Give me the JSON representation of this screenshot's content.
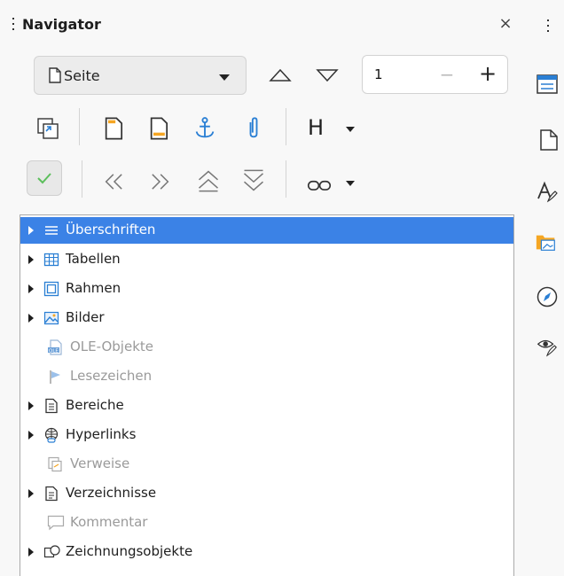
{
  "panel": {
    "title": "Navigator",
    "close_glyph": "×"
  },
  "toolbar": {
    "content_type": "Seite",
    "page_number": "1",
    "minus_glyph": "−",
    "plus_glyph": "+",
    "heading_level_glyph": "H"
  },
  "tree": {
    "items": [
      {
        "label": "Überschriften",
        "icon": "headings-icon",
        "expandable": true,
        "selected": true,
        "disabled": false
      },
      {
        "label": "Tabellen",
        "icon": "table-icon",
        "expandable": true,
        "selected": false,
        "disabled": false
      },
      {
        "label": "Rahmen",
        "icon": "frame-icon",
        "expandable": true,
        "selected": false,
        "disabled": false
      },
      {
        "label": "Bilder",
        "icon": "image-icon",
        "expandable": true,
        "selected": false,
        "disabled": false
      },
      {
        "label": "OLE-Objekte",
        "icon": "ole-object-icon",
        "expandable": false,
        "selected": false,
        "disabled": true
      },
      {
        "label": "Lesezeichen",
        "icon": "bookmark-icon",
        "expandable": false,
        "selected": false,
        "disabled": true
      },
      {
        "label": "Bereiche",
        "icon": "section-icon",
        "expandable": true,
        "selected": false,
        "disabled": false
      },
      {
        "label": "Hyperlinks",
        "icon": "hyperlink-globe-icon",
        "expandable": true,
        "selected": false,
        "disabled": false
      },
      {
        "label": "Verweise",
        "icon": "reference-icon",
        "expandable": false,
        "selected": false,
        "disabled": true
      },
      {
        "label": "Verzeichnisse",
        "icon": "index-icon",
        "expandable": true,
        "selected": false,
        "disabled": false
      },
      {
        "label": "Kommentar",
        "icon": "comment-icon",
        "expandable": false,
        "selected": false,
        "disabled": true
      },
      {
        "label": "Zeichnungsobjekte",
        "icon": "drawing-object-icon",
        "expandable": true,
        "selected": false,
        "disabled": false
      }
    ]
  },
  "sidebar": {
    "icons": [
      "properties-icon",
      "page-icon",
      "styles-icon",
      "gallery-icon",
      "navigator-icon",
      "style-inspector-icon"
    ]
  },
  "colors": {
    "selection": "#3b82e6",
    "accent_blue": "#2a7fd4",
    "check_green": "#5cbf5c",
    "gallery_orange": "#f5a623"
  }
}
